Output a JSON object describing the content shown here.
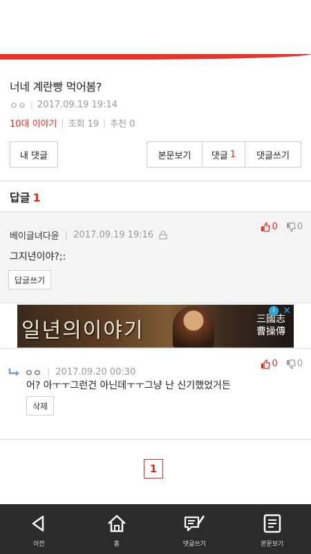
{
  "post": {
    "title": "너네 계란빵 먹어봄?",
    "author": "ㅇㅇ",
    "datetime": "2017.09.19 19:14",
    "category": "10대 이야기",
    "views_label": "조회 19",
    "recommend_label": "추천 0"
  },
  "buttons": {
    "my_comments": "내 댓글",
    "view_post": "본문보기",
    "comments_label": "댓글",
    "comments_count": "1",
    "write_comment": "댓글쓰기"
  },
  "replies": {
    "heading": "답글",
    "count": "1"
  },
  "comments": [
    {
      "author": "베이글녀다윤",
      "datetime": "2017.09.19 19:16",
      "body": "그지년이야?;:",
      "upvotes": "0",
      "downvotes": "0",
      "action": "답글쓰기"
    },
    {
      "author": "ㅇㅇ",
      "datetime": "2017.09.20 00:30",
      "body": "어? 아ㅜㅜ그런건 아닌데ㅜㅜ그냥 난 신기했었거든",
      "upvotes": "0",
      "downvotes": "0",
      "action": "삭제"
    }
  ],
  "ad": {
    "title": "일년의이야기",
    "logo_line1": "三國志",
    "logo_line2": "曹操傳"
  },
  "pagination": {
    "current": "1"
  },
  "bottom_nav": [
    {
      "label": "이전",
      "icon": "back-triangle-icon"
    },
    {
      "label": "홈",
      "icon": "home-icon"
    },
    {
      "label": "댓글쓰기",
      "icon": "comment-write-icon"
    },
    {
      "label": "본문보기",
      "icon": "document-icon"
    }
  ],
  "colors": {
    "accent": "#e02a1f",
    "nav_bg": "#2b2b2b",
    "comment_bg": "#f5f5f5"
  }
}
